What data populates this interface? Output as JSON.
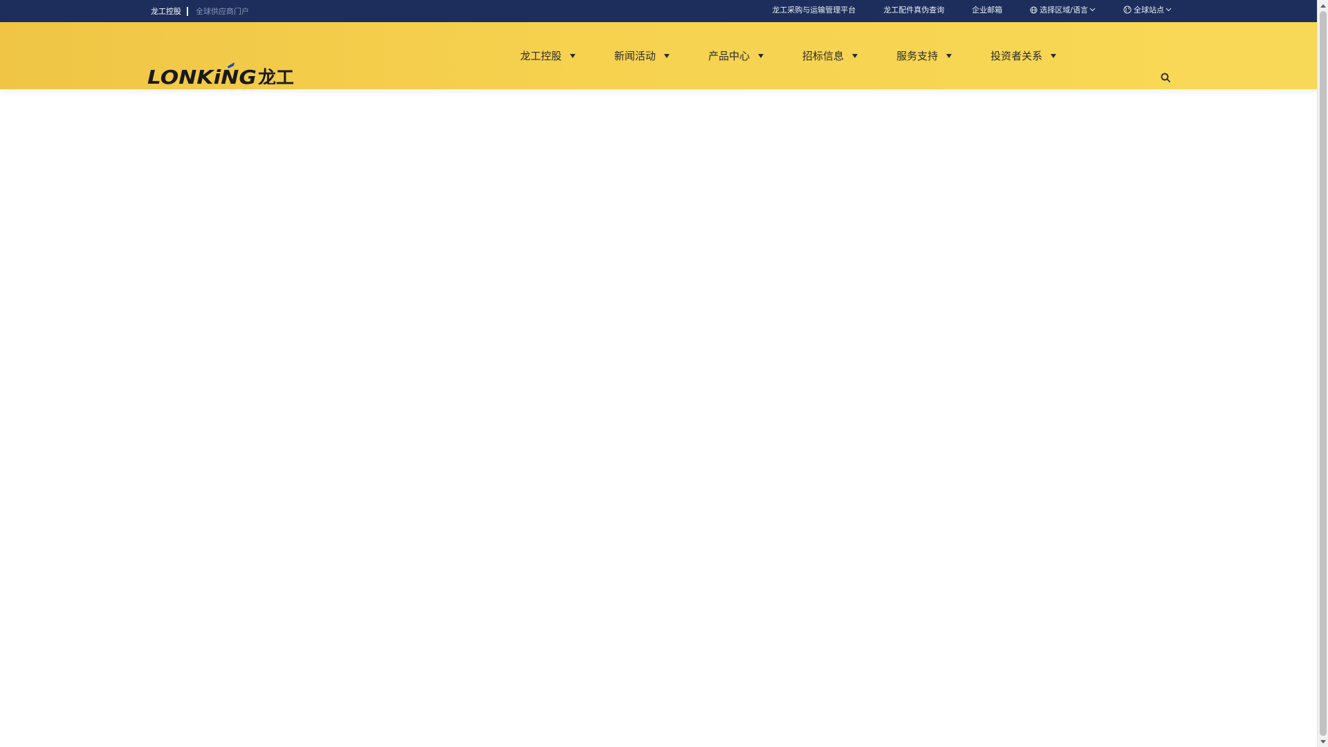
{
  "topbar": {
    "brand": "龙工控股",
    "portal": "全球供应商门户",
    "links": [
      "龙工采购与运输管理平台",
      "龙工配件真伪查询",
      "企业邮箱"
    ],
    "region_select": "选择区域/语言",
    "site_select": "全球站点"
  },
  "header": {
    "logo_text": "LONKING龙工",
    "nav": [
      "龙工控股",
      "新闻活动",
      "产品中心",
      "招标信息",
      "服务支持",
      "投资者关系"
    ]
  },
  "colors": {
    "topbar_bg": "#1d2e5c",
    "header_yellow": "#f6d24f",
    "logo_blue": "#1e4fa3",
    "logo_dark": "#1a1a1a"
  },
  "icons": {
    "search": "search-icon",
    "globe": "globe-icon",
    "earth": "earth-icon",
    "chevron": "chevron-down-icon"
  }
}
